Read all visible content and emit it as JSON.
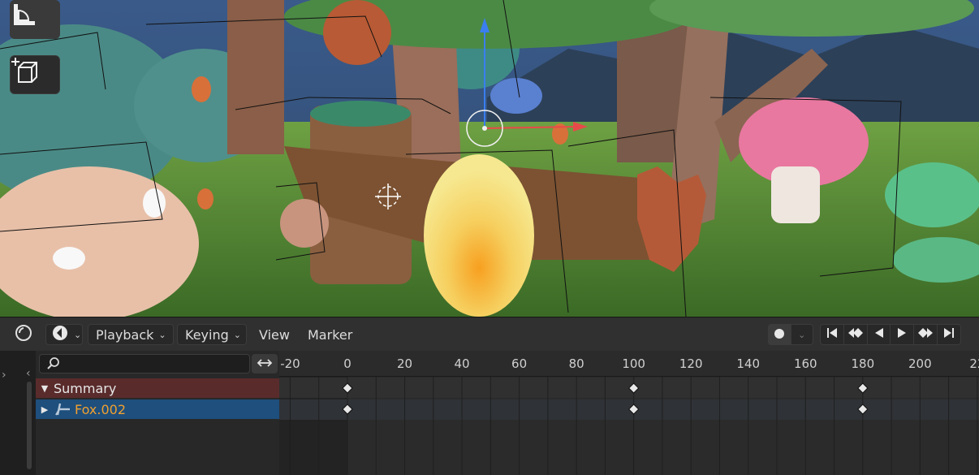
{
  "viewport": {
    "tools": [
      {
        "name": "measure-tool",
        "icon": "ruler-icon"
      },
      {
        "name": "add-cube-tool",
        "icon": "add-cube-icon"
      }
    ]
  },
  "header": {
    "editor_type_icon": "dopesheet-clock-icon",
    "mode_icon": "action-mode-icon",
    "menus": {
      "playback": "Playback",
      "keying": "Keying",
      "view": "View",
      "marker": "Marker"
    },
    "record_icon": "record-dot-icon",
    "playback_controls": [
      "jump-start-icon",
      "jump-prev-keyframe-icon",
      "play-reverse-icon",
      "play-icon",
      "jump-next-keyframe-icon",
      "jump-end-icon"
    ]
  },
  "channels": {
    "search": {
      "value": "",
      "placeholder": ""
    },
    "summary": {
      "label": "Summary",
      "color": "#5a2b2b"
    },
    "object": {
      "label": "Fox.002",
      "color": "#1e4f7d",
      "text_color": "#f0a030",
      "icon": "armature-icon"
    }
  },
  "timeline": {
    "ticks": [
      "-20",
      "0",
      "20",
      "40",
      "60",
      "80",
      "100",
      "120",
      "140",
      "160",
      "180",
      "200",
      "22"
    ],
    "keyframes": {
      "summary": [
        0,
        100,
        180
      ],
      "object": [
        0,
        100,
        180
      ]
    }
  }
}
